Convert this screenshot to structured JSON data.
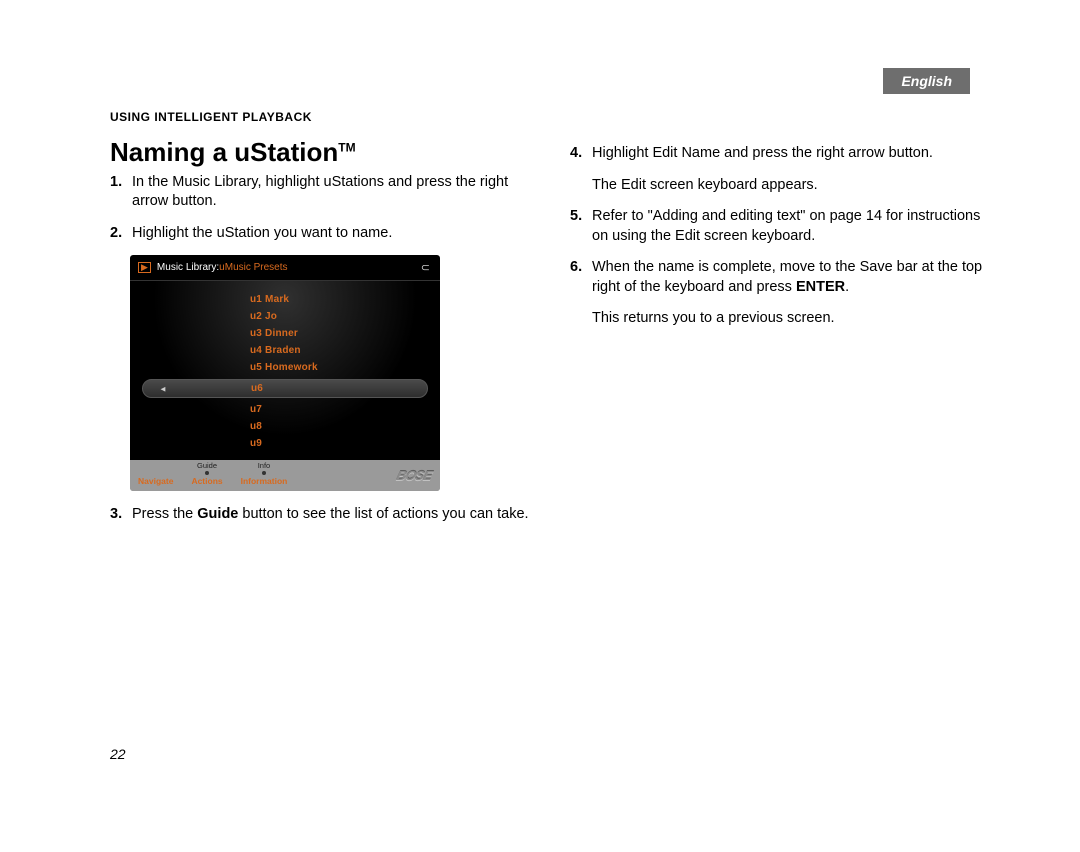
{
  "language_tab": "English",
  "section_label": "Using intelligent playback",
  "title_prefix": "Naming a uStation",
  "title_tm": "TM",
  "steps_left": [
    {
      "n": "1.",
      "text": "In the Music Library, highlight uStations and press the right arrow button."
    },
    {
      "n": "2.",
      "text": "Highlight the uStation you want to name."
    }
  ],
  "step3": {
    "n": "3.",
    "pre": "Press the ",
    "bold": "Guide",
    "post": " button to see the list of actions you can take."
  },
  "step4": {
    "n": "4.",
    "text": "Highlight Edit Name and press the right arrow button."
  },
  "step4_note": "The Edit screen keyboard appears.",
  "step5": {
    "n": "5.",
    "text": "Refer to \"Adding and editing text\" on page 14 for instructions on using the Edit screen keyboard."
  },
  "step6": {
    "n": "6.",
    "pre": "When the name is complete, move to the Save bar at the top right of the keyboard and press ",
    "bold": "ENTER",
    "post": "."
  },
  "step6_note": "This returns you to a previous screen.",
  "page_number": "22",
  "device": {
    "breadcrumb_white": "Music Library: ",
    "breadcrumb_orange": "uMusic Presets",
    "stations": [
      {
        "label": "u1 Mark"
      },
      {
        "label": "u2 Jo"
      },
      {
        "label": "u3 Dinner"
      },
      {
        "label": "u4 Braden"
      },
      {
        "label": "u5 Homework"
      },
      {
        "label": "u6",
        "selected": true
      },
      {
        "label": "u7"
      },
      {
        "label": "u8"
      },
      {
        "label": "u9"
      }
    ],
    "footer": {
      "navigate": "Navigate",
      "guide_btn": "Guide",
      "actions": "Actions",
      "info_btn": "Info",
      "information": "Information",
      "brand": "BOSE"
    }
  }
}
